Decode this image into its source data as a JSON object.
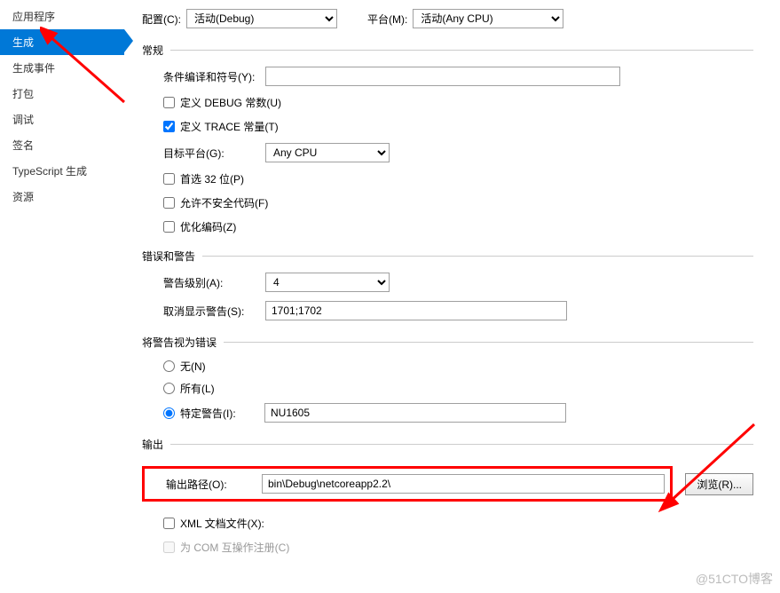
{
  "sidebar": {
    "items": [
      {
        "label": "应用程序"
      },
      {
        "label": "生成"
      },
      {
        "label": "生成事件"
      },
      {
        "label": "打包"
      },
      {
        "label": "调试"
      },
      {
        "label": "签名"
      },
      {
        "label": "TypeScript 生成"
      },
      {
        "label": "资源"
      }
    ]
  },
  "config": {
    "config_label": "配置(C):",
    "config_value": "活动(Debug)",
    "platform_label": "平台(M):",
    "platform_value": "活动(Any CPU)"
  },
  "section_general": "常规",
  "general": {
    "symbols_label": "条件编译和符号(Y):",
    "symbols_value": "",
    "define_debug": "定义 DEBUG 常数(U)",
    "define_trace": "定义 TRACE 常量(T)",
    "target_label": "目标平台(G):",
    "target_value": "Any CPU",
    "prefer32": "首选 32 位(P)",
    "unsafe": "允许不安全代码(F)",
    "optimize": "优化编码(Z)"
  },
  "section_warnings": "错误和警告",
  "warnings": {
    "level_label": "警告级别(A):",
    "level_value": "4",
    "suppress_label": "取消显示警告(S):",
    "suppress_value": "1701;1702"
  },
  "section_treat": "将警告视为错误",
  "treat": {
    "none": "无(N)",
    "all": "所有(L)",
    "specific": "特定警告(I):",
    "specific_value": "NU1605"
  },
  "section_output": "输出",
  "output": {
    "path_label": "输出路径(O):",
    "path_value": "bin\\Debug\\netcoreapp2.2\\",
    "browse": "浏览(R)...",
    "xml": "XML 文档文件(X):",
    "com": "为 COM 互操作注册(C)"
  },
  "watermark": "@51CTO博客"
}
